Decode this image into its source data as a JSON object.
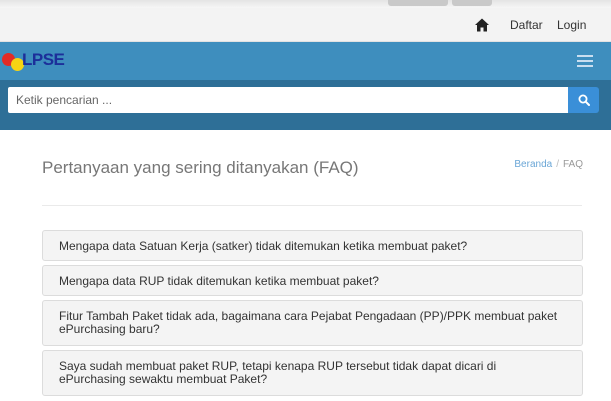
{
  "topnav": {
    "home_icon": "home-icon",
    "daftar_label": "Daftar",
    "login_label": "Login"
  },
  "brand": {
    "logo_text": "LPSE",
    "menu_icon": "hamburger-icon",
    "bar_color": "#3e8ebe"
  },
  "search": {
    "placeholder": "Ketik pencarian ...",
    "value": "",
    "button_icon": "search-icon",
    "button_color": "#3a8fd8"
  },
  "page": {
    "title": "Pertanyaan yang sering ditanyakan (FAQ)",
    "breadcrumb": {
      "home": "Beranda",
      "separator": "/",
      "current": "FAQ"
    }
  },
  "faq": {
    "items": [
      {
        "question": "Mengapa data Satuan Kerja (satker) tidak ditemukan ketika membuat paket?"
      },
      {
        "question": "Mengapa data RUP tidak ditemukan ketika membuat paket?"
      },
      {
        "question": "Fitur Tambah Paket tidak ada, bagaimana cara Pejabat Pengadaan (PP)/PPK membuat paket ePurchasing baru?"
      },
      {
        "question": "Saya sudah membuat paket RUP, tetapi kenapa RUP tersebut tidak dapat dicari di ePurchasing sewaktu membuat Paket?"
      }
    ]
  }
}
